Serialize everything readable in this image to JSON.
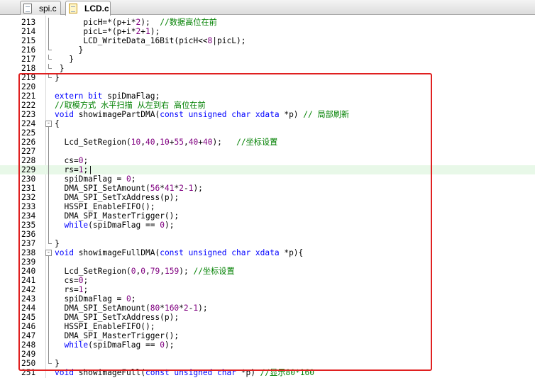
{
  "tabs": [
    {
      "label": "spi.c",
      "active": false
    },
    {
      "label": "LCD.c",
      "active": true
    }
  ],
  "colors": {
    "keyword": "#0000ff",
    "comment": "#008000",
    "number": "#800080",
    "text": "#000000",
    "highlight_box": "#e02020",
    "current_line": "#e8f8e8"
  },
  "current_line": 229,
  "lines": [
    {
      "n": "213",
      "fold": "v",
      "code": [
        [
          "t",
          "      picH=*(p+i*"
        ],
        [
          "n",
          "2"
        ],
        [
          "t",
          ");  "
        ],
        [
          "c",
          "//数据高位在前"
        ]
      ]
    },
    {
      "n": "214",
      "fold": "v",
      "code": [
        [
          "t",
          "      picL=*(p+i*"
        ],
        [
          "n",
          "2"
        ],
        [
          "t",
          "+"
        ],
        [
          "n",
          "1"
        ],
        [
          "t",
          ");"
        ]
      ]
    },
    {
      "n": "215",
      "fold": "v",
      "code": [
        [
          "t",
          "      LCD_WriteData_16Bit(picH<<"
        ],
        [
          "n",
          "8"
        ],
        [
          "t",
          "|picL);"
        ]
      ]
    },
    {
      "n": "216",
      "fold": "end",
      "code": [
        [
          "t",
          "     }"
        ]
      ]
    },
    {
      "n": "217",
      "fold": "end",
      "code": [
        [
          "t",
          "   }"
        ]
      ]
    },
    {
      "n": "218",
      "fold": "end",
      "code": [
        [
          "t",
          " }"
        ]
      ]
    },
    {
      "n": "219",
      "fold": "end",
      "code": [
        [
          "t",
          "}"
        ]
      ]
    },
    {
      "n": "220",
      "fold": "",
      "code": []
    },
    {
      "n": "221",
      "fold": "",
      "code": [
        [
          "k",
          "extern bit"
        ],
        [
          "t",
          " spiDmaFlag;"
        ]
      ]
    },
    {
      "n": "222",
      "fold": "",
      "code": [
        [
          "c",
          "//取模方式 水平扫描 从左到右 高位在前"
        ]
      ]
    },
    {
      "n": "223",
      "fold": "",
      "code": [
        [
          "k",
          "void"
        ],
        [
          "t",
          " showimagePartDMA("
        ],
        [
          "k",
          "const unsigned char xdata"
        ],
        [
          "t",
          " *p) "
        ],
        [
          "c",
          "// 局部刷新"
        ]
      ]
    },
    {
      "n": "224",
      "fold": "box",
      "code": [
        [
          "t",
          "{"
        ]
      ]
    },
    {
      "n": "225",
      "fold": "v",
      "code": []
    },
    {
      "n": "226",
      "fold": "v",
      "code": [
        [
          "t",
          "  Lcd_SetRegion("
        ],
        [
          "n",
          "10"
        ],
        [
          "t",
          ","
        ],
        [
          "n",
          "40"
        ],
        [
          "t",
          ","
        ],
        [
          "n",
          "10"
        ],
        [
          "t",
          "+"
        ],
        [
          "n",
          "55"
        ],
        [
          "t",
          ","
        ],
        [
          "n",
          "40"
        ],
        [
          "t",
          "+"
        ],
        [
          "n",
          "40"
        ],
        [
          "t",
          ");   "
        ],
        [
          "c",
          "//坐标设置"
        ]
      ]
    },
    {
      "n": "227",
      "fold": "v",
      "code": []
    },
    {
      "n": "228",
      "fold": "v",
      "code": [
        [
          "t",
          "  cs="
        ],
        [
          "n",
          "0"
        ],
        [
          "t",
          ";"
        ]
      ]
    },
    {
      "n": "229",
      "fold": "v",
      "code": [
        [
          "t",
          "  rs="
        ],
        [
          "n",
          "1"
        ],
        [
          "t",
          ";|"
        ]
      ]
    },
    {
      "n": "230",
      "fold": "v",
      "code": [
        [
          "t",
          "  spiDmaFlag = "
        ],
        [
          "n",
          "0"
        ],
        [
          "t",
          ";"
        ]
      ]
    },
    {
      "n": "231",
      "fold": "v",
      "code": [
        [
          "t",
          "  DMA_SPI_SetAmount("
        ],
        [
          "n",
          "56"
        ],
        [
          "t",
          "*"
        ],
        [
          "n",
          "41"
        ],
        [
          "t",
          "*"
        ],
        [
          "n",
          "2"
        ],
        [
          "t",
          "-"
        ],
        [
          "n",
          "1"
        ],
        [
          "t",
          ");"
        ]
      ]
    },
    {
      "n": "232",
      "fold": "v",
      "code": [
        [
          "t",
          "  DMA_SPI_SetTxAddress(p);"
        ]
      ]
    },
    {
      "n": "233",
      "fold": "v",
      "code": [
        [
          "t",
          "  HSSPI_EnableFIFO();"
        ]
      ]
    },
    {
      "n": "234",
      "fold": "v",
      "code": [
        [
          "t",
          "  DMA_SPI_MasterTrigger();"
        ]
      ]
    },
    {
      "n": "235",
      "fold": "v",
      "code": [
        [
          "t",
          "  "
        ],
        [
          "k",
          "while"
        ],
        [
          "t",
          "(spiDmaFlag == "
        ],
        [
          "n",
          "0"
        ],
        [
          "t",
          ");"
        ]
      ]
    },
    {
      "n": "236",
      "fold": "v",
      "code": []
    },
    {
      "n": "237",
      "fold": "end",
      "code": [
        [
          "t",
          "}"
        ]
      ]
    },
    {
      "n": "238",
      "fold": "box",
      "code": [
        [
          "k",
          "void"
        ],
        [
          "t",
          " showimageFullDMA("
        ],
        [
          "k",
          "const unsigned char xdata"
        ],
        [
          "t",
          " *p){"
        ]
      ]
    },
    {
      "n": "239",
      "fold": "v",
      "code": []
    },
    {
      "n": "240",
      "fold": "v",
      "code": [
        [
          "t",
          "  Lcd_SetRegion("
        ],
        [
          "n",
          "0"
        ],
        [
          "t",
          ","
        ],
        [
          "n",
          "0"
        ],
        [
          "t",
          ","
        ],
        [
          "n",
          "79"
        ],
        [
          "t",
          ","
        ],
        [
          "n",
          "159"
        ],
        [
          "t",
          "); "
        ],
        [
          "c",
          "//坐标设置"
        ]
      ]
    },
    {
      "n": "241",
      "fold": "v",
      "code": [
        [
          "t",
          "  cs="
        ],
        [
          "n",
          "0"
        ],
        [
          "t",
          ";"
        ]
      ]
    },
    {
      "n": "242",
      "fold": "v",
      "code": [
        [
          "t",
          "  rs="
        ],
        [
          "n",
          "1"
        ],
        [
          "t",
          ";"
        ]
      ]
    },
    {
      "n": "243",
      "fold": "v",
      "code": [
        [
          "t",
          "  spiDmaFlag = "
        ],
        [
          "n",
          "0"
        ],
        [
          "t",
          ";"
        ]
      ]
    },
    {
      "n": "244",
      "fold": "v",
      "code": [
        [
          "t",
          "  DMA_SPI_SetAmount("
        ],
        [
          "n",
          "80"
        ],
        [
          "t",
          "*"
        ],
        [
          "n",
          "160"
        ],
        [
          "t",
          "*"
        ],
        [
          "n",
          "2"
        ],
        [
          "t",
          "-"
        ],
        [
          "n",
          "1"
        ],
        [
          "t",
          ");"
        ]
      ]
    },
    {
      "n": "245",
      "fold": "v",
      "code": [
        [
          "t",
          "  DMA_SPI_SetTxAddress(p);"
        ]
      ]
    },
    {
      "n": "246",
      "fold": "v",
      "code": [
        [
          "t",
          "  HSSPI_EnableFIFO();"
        ]
      ]
    },
    {
      "n": "247",
      "fold": "v",
      "code": [
        [
          "t",
          "  DMA_SPI_MasterTrigger();"
        ]
      ]
    },
    {
      "n": "248",
      "fold": "v",
      "code": [
        [
          "t",
          "  "
        ],
        [
          "k",
          "while"
        ],
        [
          "t",
          "(spiDmaFlag == "
        ],
        [
          "n",
          "0"
        ],
        [
          "t",
          ");"
        ]
      ]
    },
    {
      "n": "249",
      "fold": "v",
      "code": []
    },
    {
      "n": "250",
      "fold": "end",
      "code": [
        [
          "t",
          "}"
        ]
      ]
    },
    {
      "n": "251",
      "fold": "",
      "code": [
        [
          "k",
          "void"
        ],
        [
          "t",
          " showimageFull("
        ],
        [
          "k",
          "const unsigned char"
        ],
        [
          "t",
          " *p) "
        ],
        [
          "c",
          "//显示80*160"
        ]
      ]
    }
  ]
}
